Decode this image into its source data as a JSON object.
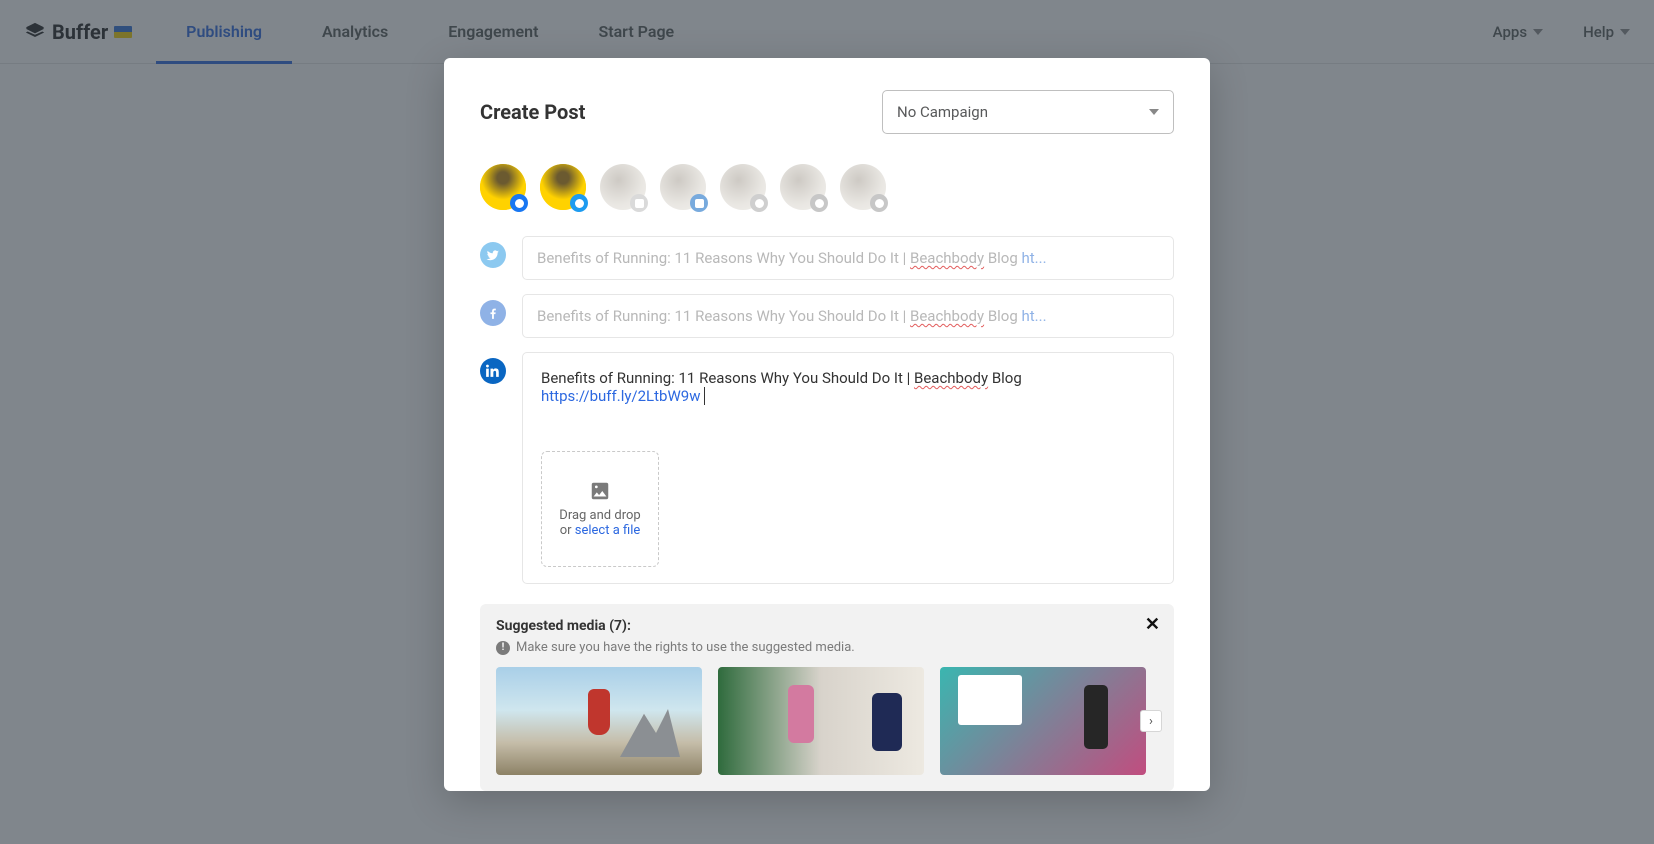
{
  "brand": "Buffer",
  "nav": {
    "publishing": "Publishing",
    "analytics": "Analytics",
    "engagement": "Engagement",
    "startpage": "Start Page"
  },
  "topright": {
    "apps": "Apps",
    "help": "Help"
  },
  "modal": {
    "title": "Create Post",
    "campaign_selected": "No Campaign",
    "post_text": "Benefits of Running: 11 Reasons Why You Should Do It | ",
    "post_text_spell": "Beachbody",
    "post_text_after": " Blog ",
    "post_link_trunc": "ht...",
    "active_post_link": "https://buff.ly/2LtbW9w",
    "dropzone_line1": "Drag and drop",
    "dropzone_or": "or ",
    "dropzone_select": "select a file",
    "suggested_title": "Suggested media (7):",
    "suggested_note": "Make sure you have the rights to use the suggested media."
  }
}
